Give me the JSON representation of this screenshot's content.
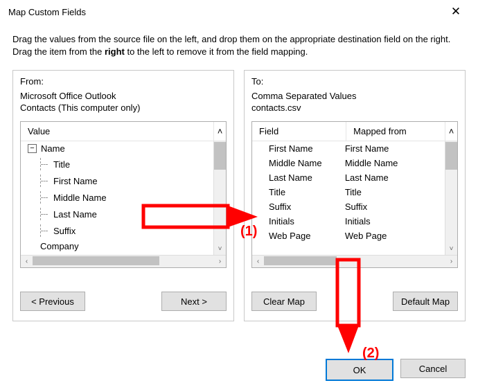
{
  "window": {
    "title": "Map Custom Fields"
  },
  "instructions": {
    "line1": "Drag the values from the source file on the left, and drop them on the appropriate destination field on the right.  Drag the item from the",
    "emph": "right",
    "line2": " to the left to remove it from the field mapping."
  },
  "from": {
    "label": "From:",
    "source": "Microsoft Office Outlook",
    "sub": "Contacts (This computer only)",
    "column": "Value",
    "tree_root": "Name",
    "items": [
      "Title",
      "First Name",
      "Middle Name",
      "Last Name",
      "Suffix"
    ],
    "after_root": "Company"
  },
  "to": {
    "label": "To:",
    "source": "Comma Separated Values",
    "sub": "contacts.csv",
    "col_field": "Field",
    "col_mapped": "Mapped from",
    "rows": [
      {
        "field": "First Name",
        "mapped": "First Name"
      },
      {
        "field": "Middle Name",
        "mapped": "Middle Name"
      },
      {
        "field": "Last Name",
        "mapped": "Last Name"
      },
      {
        "field": "Title",
        "mapped": "Title"
      },
      {
        "field": "Suffix",
        "mapped": "Suffix"
      },
      {
        "field": "Initials",
        "mapped": "Initials"
      },
      {
        "field": "Web Page",
        "mapped": "Web Page"
      }
    ]
  },
  "buttons": {
    "prev": "<  Previous",
    "next": "Next  >",
    "clear": "Clear Map",
    "default": "Default Map",
    "ok": "OK",
    "cancel": "Cancel"
  },
  "annotations": {
    "label1": "(1)",
    "label2": "(2)",
    "color": "#ff0000"
  }
}
